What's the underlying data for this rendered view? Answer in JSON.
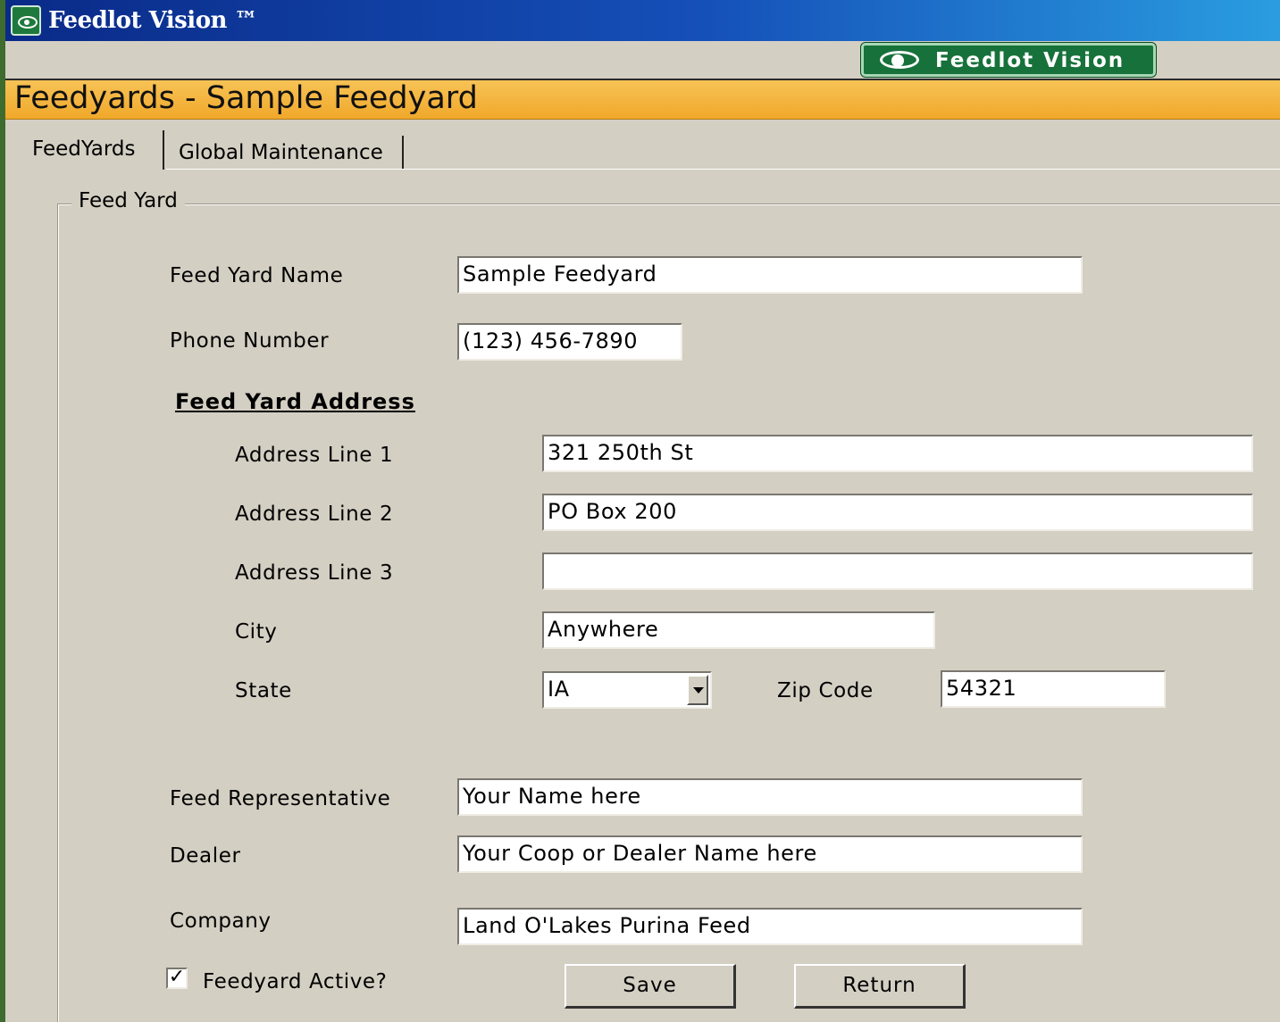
{
  "window": {
    "title": "Feedlot Vision ™"
  },
  "logo": {
    "text": "Feedlot Vision"
  },
  "header": {
    "title": "Feedyards - Sample Feedyard"
  },
  "tabs": [
    {
      "label": "FeedYards"
    },
    {
      "label": "Global Maintenance"
    }
  ],
  "group": {
    "legend": "Feed Yard"
  },
  "form": {
    "feed_yard_name": {
      "label": "Feed Yard Name",
      "value": "Sample Feedyard"
    },
    "phone_number": {
      "label": "Phone Number",
      "value": "(123) 456-7890"
    },
    "address_heading": "Feed Yard Address",
    "address_line_1": {
      "label": "Address Line 1",
      "value": "321 250th St"
    },
    "address_line_2": {
      "label": "Address Line 2",
      "value": "PO Box 200"
    },
    "address_line_3": {
      "label": "Address Line 3",
      "value": ""
    },
    "city": {
      "label": "City",
      "value": "Anywhere"
    },
    "state": {
      "label": "State",
      "value": "IA"
    },
    "zip_code": {
      "label": "Zip Code",
      "value": "54321"
    },
    "feed_representative": {
      "label": "Feed Representative",
      "value": "Your Name here"
    },
    "dealer": {
      "label": "Dealer",
      "value": "Your Coop or Dealer Name here"
    },
    "company": {
      "label": "Company",
      "value": "Land O'Lakes Purina Feed"
    },
    "feedyard_active": {
      "label": "Feedyard Active?",
      "checked": true,
      "mark": "✓"
    }
  },
  "buttons": {
    "save": "Save",
    "return": "Return"
  }
}
